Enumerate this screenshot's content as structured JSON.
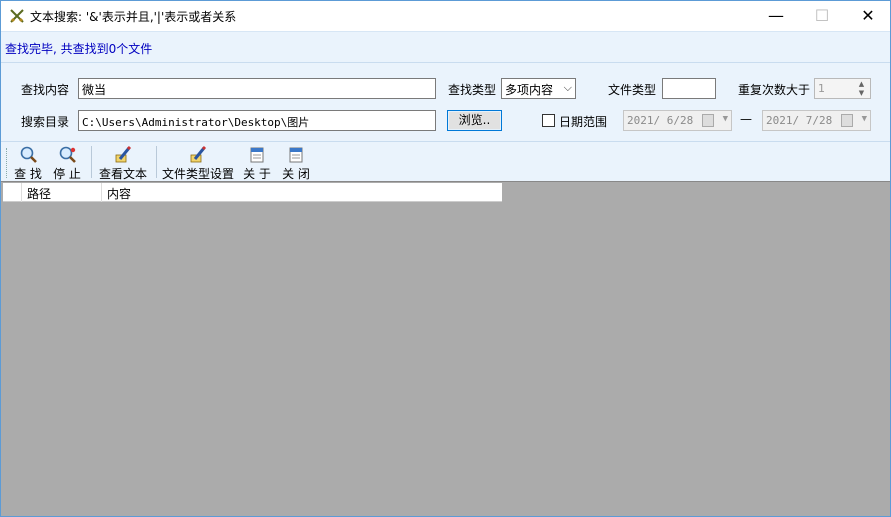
{
  "window": {
    "title": "文本搜索: '&'表示并且,'|'表示或者关系",
    "minimize": "—",
    "maximize": "☐",
    "close": "✕"
  },
  "status": {
    "text": "查找完毕, 共查找到0个文件"
  },
  "form": {
    "find_content_label": "查找内容",
    "find_content_value": "微当",
    "find_type_label": "查找类型",
    "find_type_value": "多项内容",
    "file_type_label": "文件类型",
    "file_type_value": "",
    "repeat_label": "重复次数大于",
    "repeat_value": "1",
    "search_dir_label": "搜索目录",
    "search_dir_value": "C:\\Users\\Administrator\\Desktop\\图片",
    "browse_label": "浏览..",
    "date_range_label": "日期范围",
    "date_range_checked": false,
    "date_from": "2021/ 6/28",
    "date_separator": "—",
    "date_to": "2021/ 7/28"
  },
  "toolbar": {
    "find": "查 找",
    "stop": "停 止",
    "view_text": "查看文本",
    "file_type_settings": "文件类型设置",
    "about": "关 于",
    "close": "关 闭"
  },
  "grid": {
    "columns": [
      "路径",
      "内容"
    ]
  },
  "icons": {
    "app": "crossed-swords-icon",
    "find": "magnifier-icon",
    "stop": "magnifier-stop-icon",
    "view_text": "pencil-icon",
    "file_type_settings": "pencil-icon",
    "about": "document-icon",
    "close": "document-icon"
  },
  "colors": {
    "panel_bg": "#eaf3fc",
    "status_text": "#0000c0",
    "result_bg": "#ababab",
    "accent": "#0078d7"
  }
}
